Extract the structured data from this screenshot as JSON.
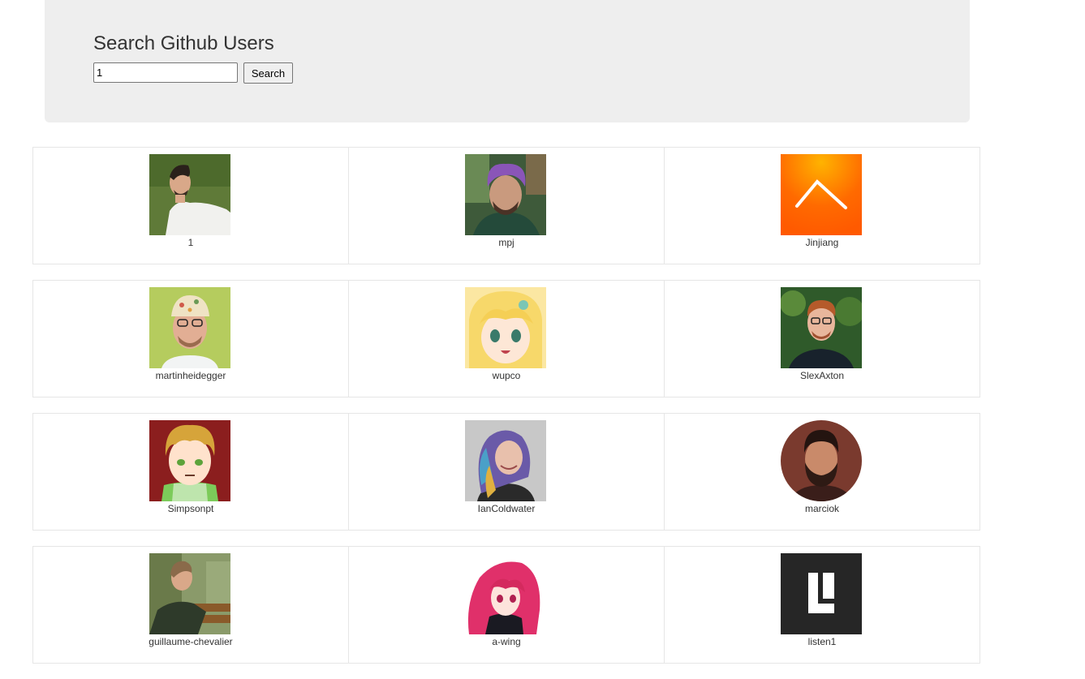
{
  "header": {
    "title": "Search Github Users",
    "search_value": "1",
    "search_button_label": "Search"
  },
  "users": [
    {
      "login": "1",
      "avatar": "man-on-grass-avatar"
    },
    {
      "login": "mpj",
      "avatar": "purple-hair-man-avatar"
    },
    {
      "login": "Jinjiang",
      "avatar": "orange-caret-logo-avatar"
    },
    {
      "login": "martinheidegger",
      "avatar": "man-with-cap-avatar"
    },
    {
      "login": "wupco",
      "avatar": "anime-blonde-girl-avatar"
    },
    {
      "login": "SlexAxton",
      "avatar": "red-haired-man-avatar"
    },
    {
      "login": "Simpsonpt",
      "avatar": "cartoon-curly-hair-avatar"
    },
    {
      "login": "IanColdwater",
      "avatar": "rainbow-hair-woman-avatar"
    },
    {
      "login": "marciok",
      "avatar": "bearded-man-round-avatar"
    },
    {
      "login": "guillaume-chevalier",
      "avatar": "man-on-bench-avatar"
    },
    {
      "login": "a-wing",
      "avatar": "anime-pink-hair-avatar"
    },
    {
      "login": "listen1",
      "avatar": "l-logo-avatar"
    }
  ]
}
